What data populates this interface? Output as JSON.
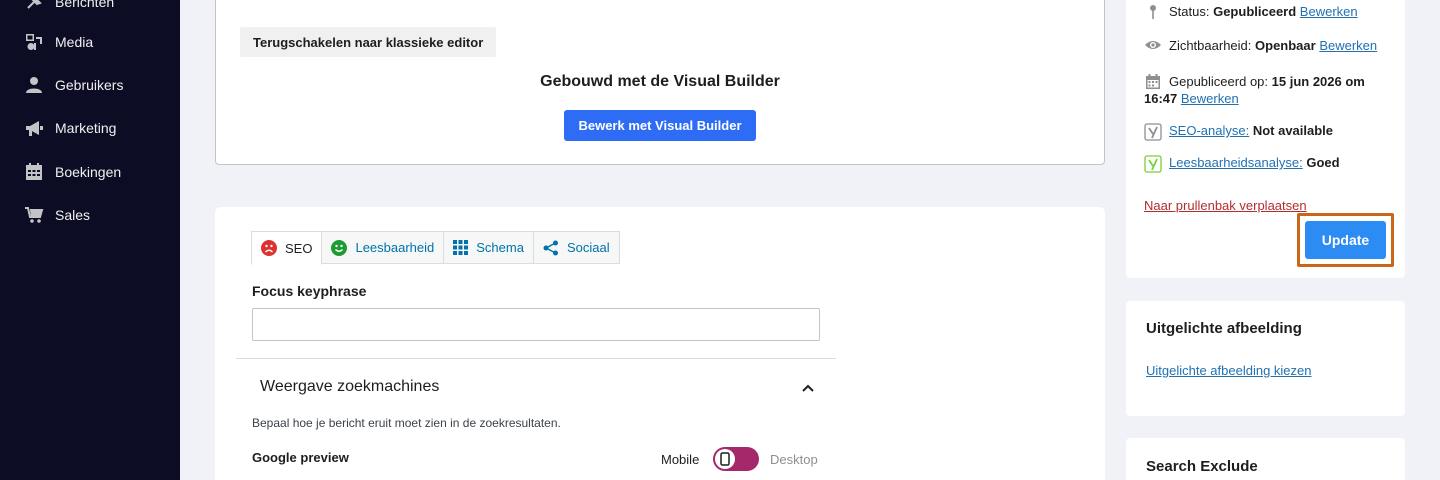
{
  "sidebar": {
    "items": [
      {
        "label": "Berichten",
        "icon": "pin-icon"
      },
      {
        "label": "Media",
        "icon": "media-icon"
      },
      {
        "label": "Gebruikers",
        "icon": "user-icon"
      },
      {
        "label": "Marketing",
        "icon": "megaphone-icon"
      },
      {
        "label": "Boekingen",
        "icon": "calendar-icon"
      },
      {
        "label": "Sales",
        "icon": "cart-icon"
      }
    ]
  },
  "builder": {
    "classic_label": "Terugschakelen naar klassieke editor",
    "title": "Gebouwd met de Visual Builder",
    "edit_label": "Bewerk met Visual Builder"
  },
  "seo": {
    "tabs": [
      {
        "label": "SEO",
        "icon": "sad-face-icon"
      },
      {
        "label": "Leesbaarheid",
        "icon": "happy-face-icon"
      },
      {
        "label": "Schema",
        "icon": "grid-icon"
      },
      {
        "label": "Sociaal",
        "icon": "share-icon"
      }
    ],
    "focus_label": "Focus keyphrase",
    "focus_value": "",
    "serp_title": "Weergave zoekmachines",
    "serp_desc": "Bepaal hoe je bericht eruit moet zien in de zoekresultaten.",
    "google_preview": "Google preview",
    "mobile": "Mobile",
    "desktop": "Desktop"
  },
  "publish": {
    "status_label": "Status:",
    "status_value": "Gepubliceerd",
    "edit": "Bewerken",
    "visibility_label": "Zichtbaarheid:",
    "visibility_value": "Openbaar",
    "published_label": "Gepubliceerd op:",
    "published_date": "15 jun 2026 om",
    "published_time": "16:47",
    "seo_label": "SEO-analyse:",
    "seo_value": "Not available",
    "read_label": "Leesbaarheidsanalyse:",
    "read_value": "Goed",
    "trash": "Naar prullenbak verplaatsen",
    "update": "Update"
  },
  "featured": {
    "title": "Uitgelichte afbeelding",
    "link": "Uitgelichte afbeelding kiezen"
  },
  "exclude": {
    "title": "Search Exclude"
  },
  "colors": {
    "sidebar_bg": "#0c0d24",
    "primary_button": "#2e6cf6",
    "update_button": "#2c8cf4",
    "highlight_frame": "#c9661a",
    "toggle": "#a4286a",
    "link": "#2271b1",
    "danger": "#b32d2e"
  }
}
